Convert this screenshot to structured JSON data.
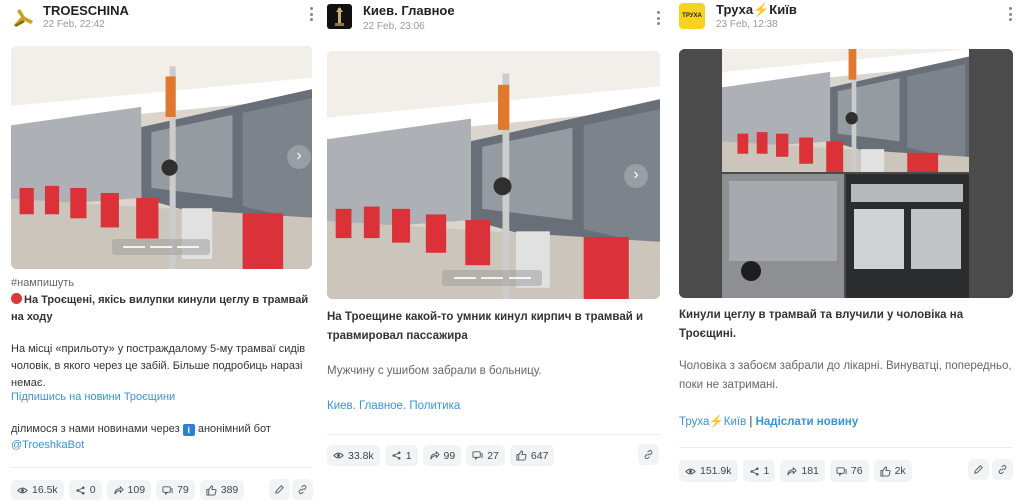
{
  "posts": [
    {
      "channel": "TROESCHINA",
      "date": "22 Feb, 22:42",
      "hashtag": "#нампишуть",
      "headline": "На Троєщені, якісь вилупки кинули цеглу в трамвай на ходу",
      "body": "На місці «прильоту» у постраждалому 5-му трамваї сидів чоловік, в якого через це забій. Більше подробиць наразі немає.",
      "subscribe_link": "Підпишись на новини Троєщини",
      "share_prefix": "ділимося з нами новинами через",
      "share_suffix": "анонімний бот",
      "bot_link": "@TroeshkaBot",
      "stats": {
        "views": "16.5k",
        "shares": "0",
        "forwards": "109",
        "comments": "79",
        "reactions": "389"
      }
    },
    {
      "channel": "Киев. Главное",
      "date": "22 Feb, 23:06",
      "headline": "На Троещине какой-то умник кинул кирпич в трамвай и травмировал пассажира",
      "body": "Мужчину с ушибом забрали в больницу.",
      "footer_link": "Киев. Главное. Политика",
      "stats": {
        "views": "33.8k",
        "shares": "1",
        "forwards": "99",
        "comments": "27",
        "reactions": "647"
      }
    },
    {
      "channel_part1": "Труха",
      "channel_part2": "Київ",
      "avatar_text": "ТРУХА",
      "date": "23 Feb, 12:38",
      "headline": "Кинули цеглу в трамвай та влучили у чоловіка на Троєщині.",
      "body": "Чоловіка з забоєм забрали до лікарні. Винуватці, попередньо, поки не затримані.",
      "footer_part1": "Труха",
      "footer_part2": "Київ",
      "footer_sep": "|",
      "footer_link": "Надіслати новину",
      "stats": {
        "views": "151.9k",
        "shares": "1",
        "forwards": "181",
        "comments": "76",
        "reactions": "2k"
      }
    }
  ],
  "icons": {
    "views": "eye-icon",
    "shares": "share-icon",
    "forwards": "forward-arrow-icon",
    "comments": "comments-icon",
    "reactions": "thumbs-up-icon",
    "edit": "pencil-icon",
    "link": "link-icon",
    "menu": "kebab-menu-icon",
    "bolt": "lightning-icon"
  },
  "colors": {
    "link": "#3a93d6",
    "seat_red": "#d8262c",
    "avatar_yellow": "#f7d21e",
    "bolt": "#e2a400"
  }
}
